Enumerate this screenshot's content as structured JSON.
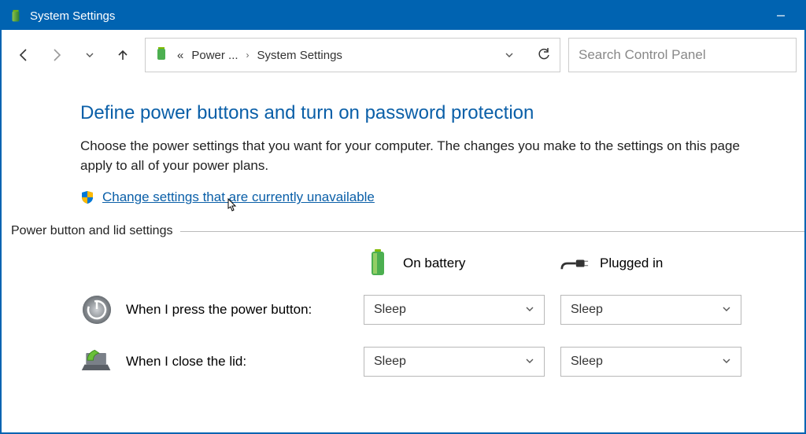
{
  "titlebar": {
    "title": "System Settings"
  },
  "toolbar": {
    "breadcrumb_prefix": "«",
    "breadcrumb1": "Power ...",
    "breadcrumb_sep": "›",
    "breadcrumb2": "System Settings",
    "search_placeholder": "Search Control Panel"
  },
  "page": {
    "heading": "Define power buttons and turn on password protection",
    "description": "Choose the power settings that you want for your computer. The changes you make to the settings on this page apply to all of your power plans.",
    "change_link": "Change settings that are currently unavailable",
    "section_label": "Power button and lid settings",
    "col_battery": "On battery",
    "col_plugged": "Plugged in",
    "rows": [
      {
        "label": "When I press the power button:",
        "battery_value": "Sleep",
        "plugged_value": "Sleep"
      },
      {
        "label": "When I close the lid:",
        "battery_value": "Sleep",
        "plugged_value": "Sleep"
      }
    ]
  }
}
